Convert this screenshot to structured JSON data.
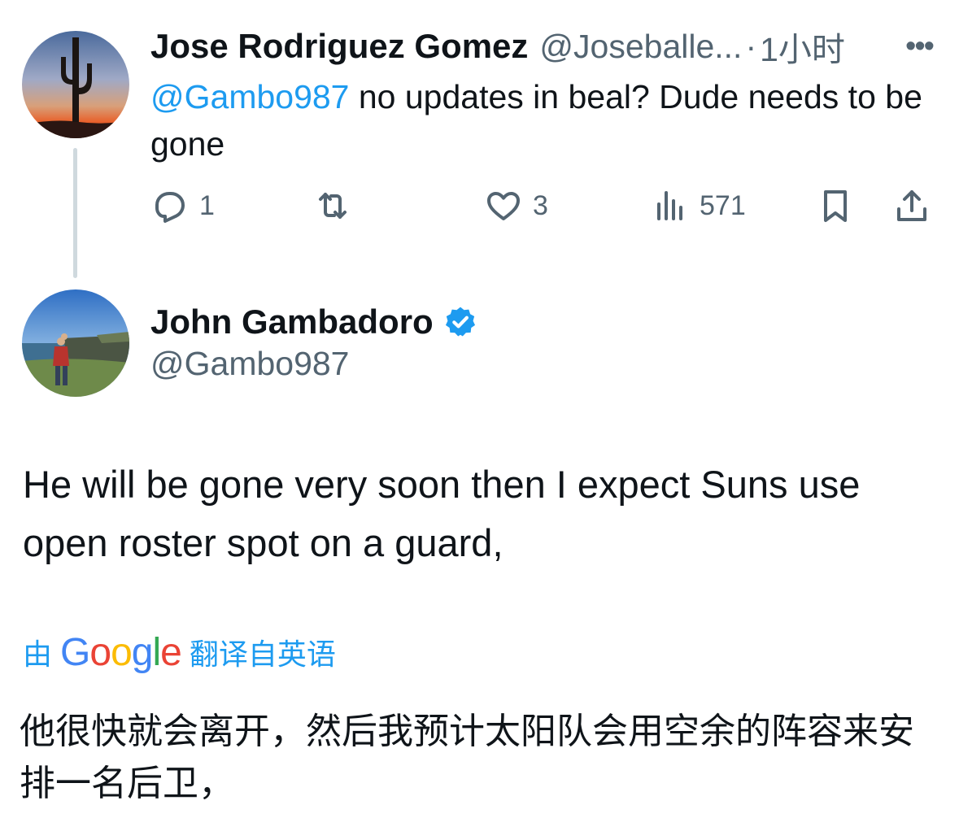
{
  "reply": {
    "author_name": "Jose Rodriguez Gomez",
    "author_handle": "@Joseballe...",
    "separator": "·",
    "time": "1小时",
    "more": "•••",
    "mention": "@Gambo987",
    "text": " no updates in beal? Dude needs to be gone",
    "actions": {
      "reply_count": "1",
      "retweet_count": "",
      "like_count": "3",
      "views_count": "571"
    }
  },
  "tweet": {
    "author_name": "John Gambadoro",
    "author_handle": "@Gambo987",
    "verified": true,
    "text": "He will be gone very soon then I expect Suns use open roster spot on a guard,",
    "translation": {
      "prefix": "由",
      "provider_letters": [
        "G",
        "o",
        "o",
        "g",
        "l",
        "e"
      ],
      "suffix": "翻译自英语",
      "text": "他很快就会离开，然后我预计太阳队会用空余的阵容来安排一名后卫，"
    }
  },
  "colors": {
    "accent": "#1d9bf0",
    "text": "#0f1419",
    "secondary": "#536471",
    "thread_line": "#cfd9de",
    "google_blue": "#4285f4",
    "google_red": "#ea4335",
    "google_yellow": "#fbbc05",
    "google_green": "#34a853"
  },
  "icons": [
    "reply-icon",
    "retweet-icon",
    "like-icon",
    "views-icon",
    "bookmark-icon",
    "share-icon",
    "verified-badge-icon",
    "more-icon"
  ]
}
